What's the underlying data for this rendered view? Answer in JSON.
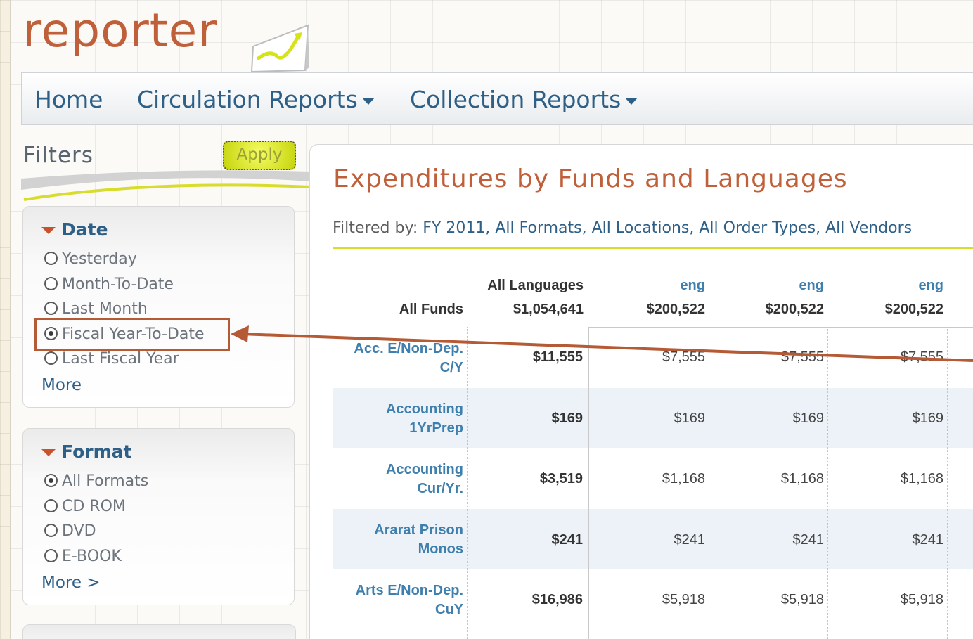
{
  "app": {
    "logo_text": "reporter"
  },
  "nav": {
    "items": [
      {
        "label": "Home",
        "dropdown": false
      },
      {
        "label": "Circulation Reports",
        "dropdown": true
      },
      {
        "label": "Collection Reports",
        "dropdown": true
      }
    ]
  },
  "filters": {
    "title": "Filters",
    "apply_label": "Apply",
    "date": {
      "heading": "Date",
      "options": [
        {
          "label": "Yesterday",
          "selected": false
        },
        {
          "label": "Month-To-Date",
          "selected": false
        },
        {
          "label": "Last Month",
          "selected": false
        },
        {
          "label": "Fiscal Year-To-Date",
          "selected": true
        },
        {
          "label": "Last Fiscal Year",
          "selected": false
        }
      ],
      "more_label": "More"
    },
    "format": {
      "heading": "Format",
      "options": [
        {
          "label": "All Formats",
          "selected": true
        },
        {
          "label": "CD ROM",
          "selected": false
        },
        {
          "label": "DVD",
          "selected": false
        },
        {
          "label": "E-BOOK",
          "selected": false
        }
      ],
      "more_label": "More >"
    }
  },
  "report": {
    "title": "Expenditures by Funds and Languages",
    "filtered_prefix": "Filtered by:",
    "filtered_values": "FY 2011, All Formats, All Locations, All Order Types, All Vendors",
    "columns": [
      {
        "name": "All Languages",
        "total": "$1,054,641"
      },
      {
        "name": "eng",
        "total": "$200,522"
      },
      {
        "name": "eng",
        "total": "$200,522"
      },
      {
        "name": "eng",
        "total": "$200,522"
      }
    ],
    "row_header": "All Funds",
    "rows": [
      {
        "fund": [
          "Acc. E/Non-Dep.",
          "C/Y"
        ],
        "values": [
          "$11,555",
          "$7,555",
          "$7,555",
          "$7,555"
        ]
      },
      {
        "fund": [
          "Accounting",
          "1YrPrep"
        ],
        "values": [
          "$169",
          "$169",
          "$169",
          "$169"
        ]
      },
      {
        "fund": [
          "Accounting",
          "Cur/Yr."
        ],
        "values": [
          "$3,519",
          "$1,168",
          "$1,168",
          "$1,168"
        ]
      },
      {
        "fund": [
          "Ararat Prison",
          "Monos"
        ],
        "values": [
          "$241",
          "$241",
          "$241",
          "$241"
        ]
      },
      {
        "fund": [
          "Arts E/Non-Dep.",
          "CuY"
        ],
        "values": [
          "$16,986",
          "$5,918",
          "$5,918",
          "$5,918"
        ]
      }
    ]
  },
  "colors": {
    "brand": "#c0603a",
    "link": "#2e5f86",
    "table_link": "#3e7fae",
    "apply_button": "#e6f01e",
    "annotation": "#b45a34"
  },
  "icons": {
    "logo_mark": "chart-trend-icon",
    "dropdown": "caret-down-icon",
    "collapse": "triangle-down-icon",
    "radio": "radio-icon"
  }
}
